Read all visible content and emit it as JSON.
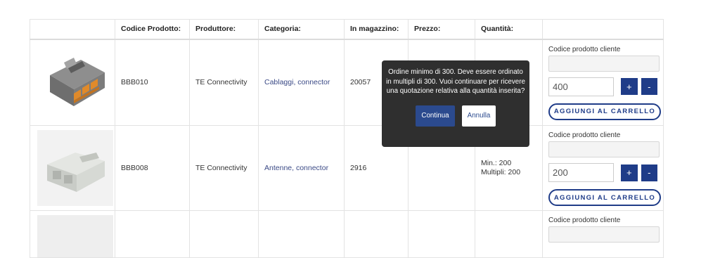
{
  "table": {
    "headers": [
      "",
      "Codice Prodotto:",
      "Produttore:",
      "Categoria:",
      "In magazzino:",
      "Prezzo:",
      "Quantità:",
      ""
    ],
    "rows": [
      {
        "image_icon": "orange-grey-connector-image",
        "code": "BBB010",
        "manufacturer": "TE Connectivity",
        "category": "Cablaggi, connector",
        "stock": "20057",
        "price": "",
        "min": "",
        "multiples": "",
        "customer_code_label": "Codice prodotto cliente",
        "customer_code_value": "",
        "quantity": "400",
        "plus": "+",
        "minus": "-",
        "cart_label": "AGGIUNGI AL CARRELLO"
      },
      {
        "image_icon": "white-connector-image",
        "code": "BBB008",
        "manufacturer": "TE Connectivity",
        "category": "Antenne, connector",
        "stock": "2916",
        "price": "",
        "min": "Min.: 200",
        "multiples": "Multipli: 200",
        "customer_code_label": "Codice prodotto cliente",
        "customer_code_value": "",
        "quantity": "200",
        "plus": "+",
        "minus": "-",
        "cart_label": "AGGIUNGI AL CARRELLO"
      },
      {
        "image_icon": "placeholder-image",
        "customer_code_label": "Codice prodotto cliente"
      }
    ]
  },
  "popup": {
    "message": "Ordine minimo di 300. Deve essere ordinato in multipli di 300. Vuoi continuare per ricevere una quotazione relativa alla quantità inserita?",
    "continue_label": "Continua",
    "cancel_label": "Annulla"
  },
  "colors": {
    "accent": "#1f3c88",
    "link": "#3b4a86",
    "popup_bg": "#2f2f2f"
  }
}
